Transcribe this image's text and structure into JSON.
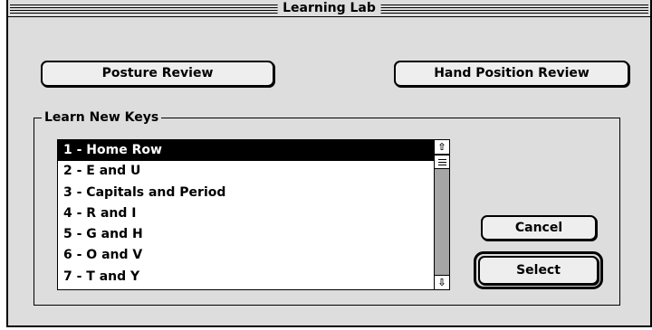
{
  "window": {
    "title": "Learning Lab"
  },
  "buttons": {
    "posture_review": "Posture Review",
    "hand_position_review": "Hand Position Review",
    "cancel": "Cancel",
    "select": "Select"
  },
  "group": {
    "label": "Learn New Keys"
  },
  "lessons": {
    "selected_index": 0,
    "items": [
      "1 - Home Row",
      "2 - E and U",
      "3 - Capitals and Period",
      "4 - R and I",
      "5 - G and H",
      "6 - O and V",
      "7 - T and Y"
    ]
  },
  "icons": {
    "scroll_up": "up-arrow-icon",
    "scroll_down": "down-arrow-icon"
  },
  "colors": {
    "window_bg": "#dddddd",
    "selection_bg": "#000000",
    "selection_fg": "#ffffff"
  }
}
